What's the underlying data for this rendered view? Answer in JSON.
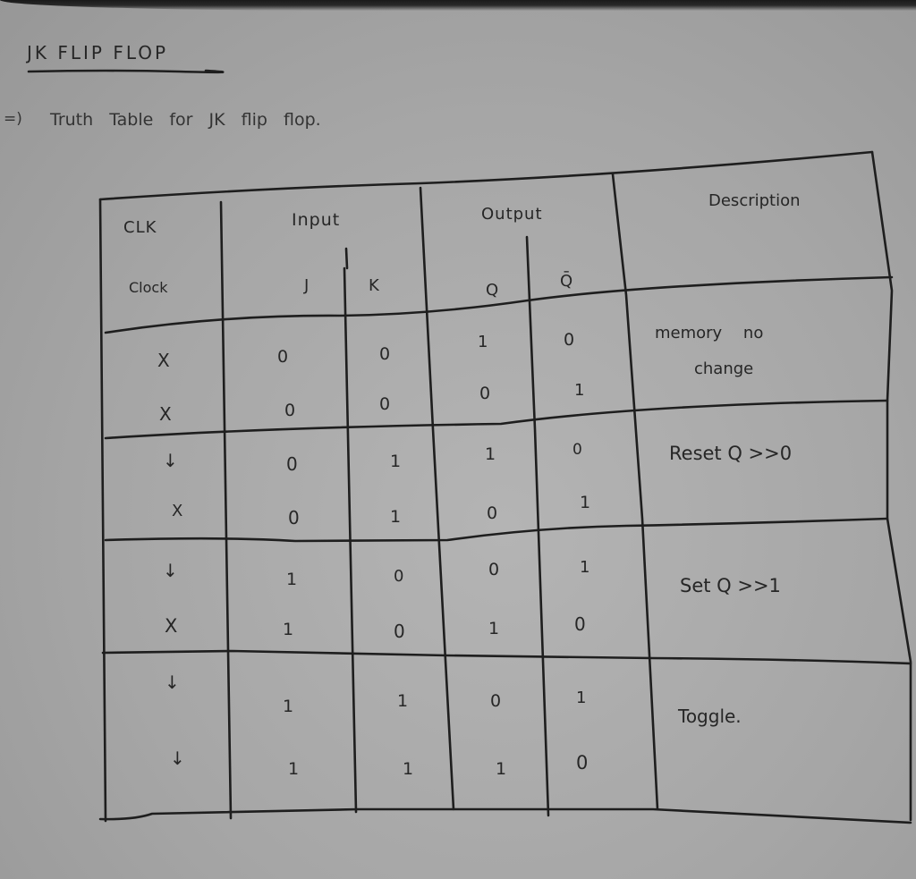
{
  "document": {
    "heading": "JK FLIP FLOP",
    "subheading_bullet": "=)",
    "subheading": "Truth Table for JK flip flop."
  },
  "table": {
    "headers": {
      "clk_top": "CLK",
      "clk_bottom": "Clock",
      "input": "Input",
      "output": "Output",
      "description": "Description",
      "j": "J",
      "k": "K",
      "q": "Q",
      "q_bar": "Q̄"
    },
    "rows": [
      {
        "clk": "X",
        "j": "0",
        "k": "0",
        "q": "1",
        "q_bar": "0"
      },
      {
        "clk": "X",
        "j": "0",
        "k": "0",
        "q": "0",
        "q_bar": "1"
      },
      {
        "clk": "↓",
        "j": "0",
        "k": "1",
        "q": "1",
        "q_bar": "0"
      },
      {
        "clk": "X",
        "j": "0",
        "k": "1",
        "q": "0",
        "q_bar": "1"
      },
      {
        "clk": "↓",
        "j": "1",
        "k": "0",
        "q": "0",
        "q_bar": "1"
      },
      {
        "clk": "X",
        "j": "1",
        "k": "0",
        "q": "1",
        "q_bar": "0"
      },
      {
        "clk": "↓",
        "j": "1",
        "k": "1",
        "q": "0",
        "q_bar": "1"
      },
      {
        "clk": "↓",
        "j": "1",
        "k": "1",
        "q": "1",
        "q_bar": "0"
      }
    ],
    "descriptions": [
      {
        "line1": "memory no",
        "line2": "change"
      },
      {
        "line1": "Reset Q >>0",
        "line2": ""
      },
      {
        "line1": "Set Q >>1",
        "line2": ""
      },
      {
        "line1": "Toggle.",
        "line2": ""
      }
    ]
  }
}
